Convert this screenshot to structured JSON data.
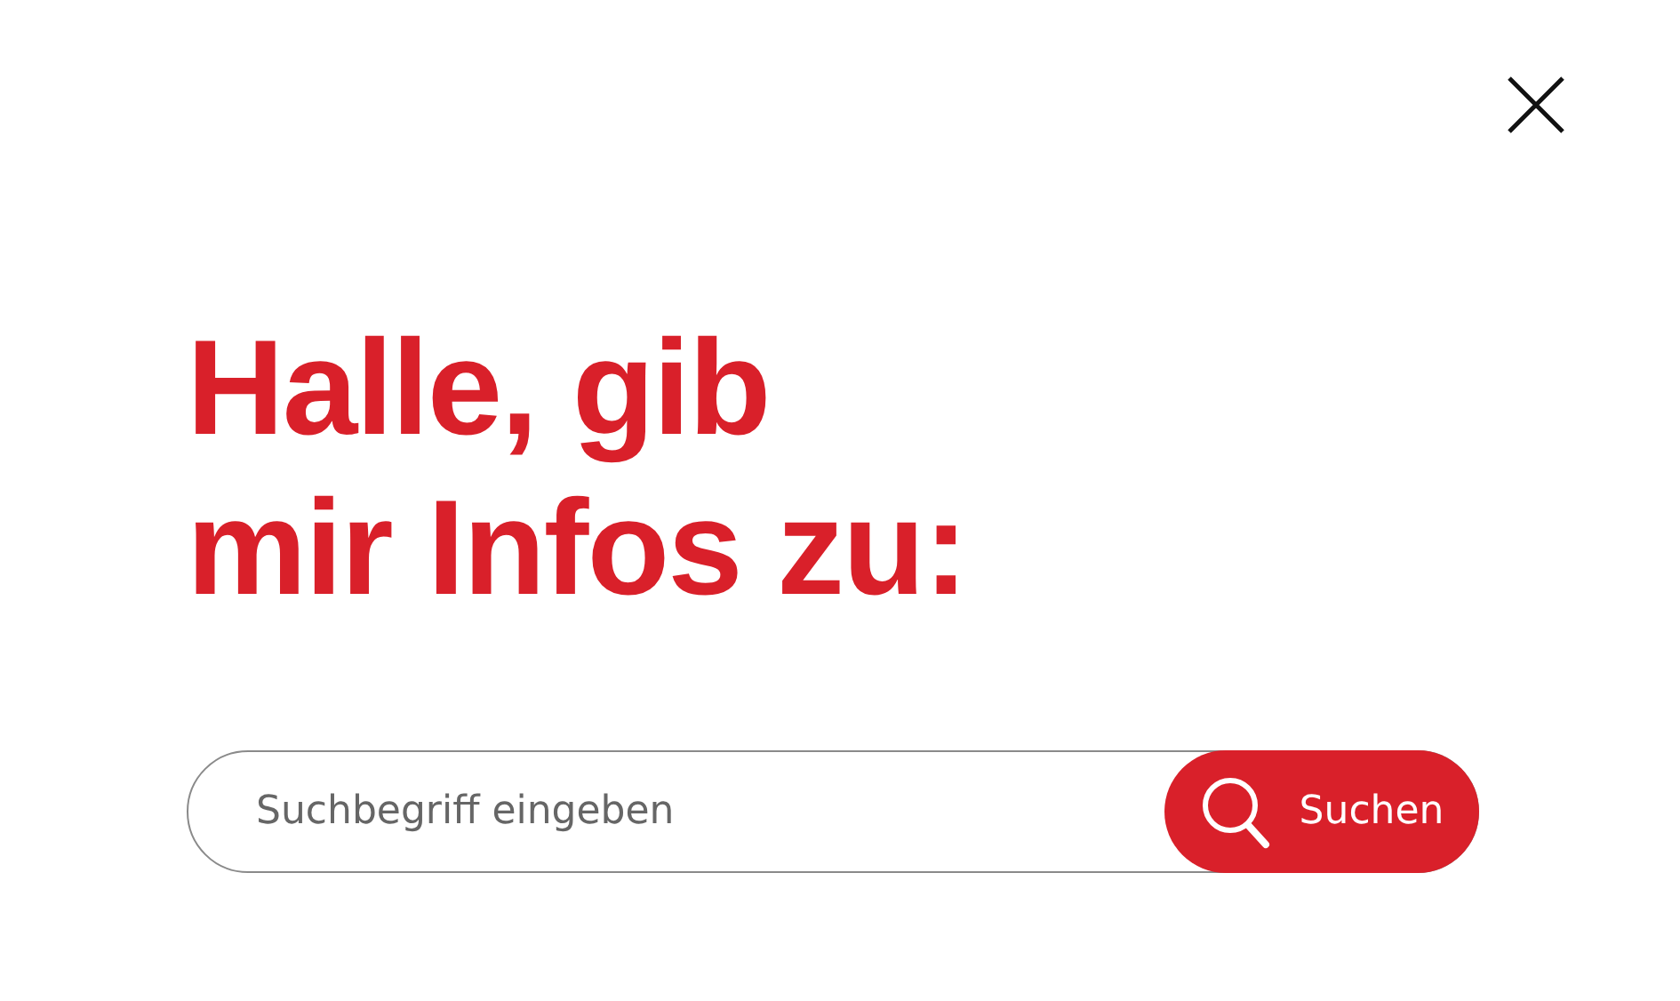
{
  "heading": {
    "lines": [
      "Halle, gib",
      "mir Infos zu:"
    ]
  },
  "search": {
    "placeholder": "Suchbegriff eingeben",
    "button_label": "Suchen"
  }
}
